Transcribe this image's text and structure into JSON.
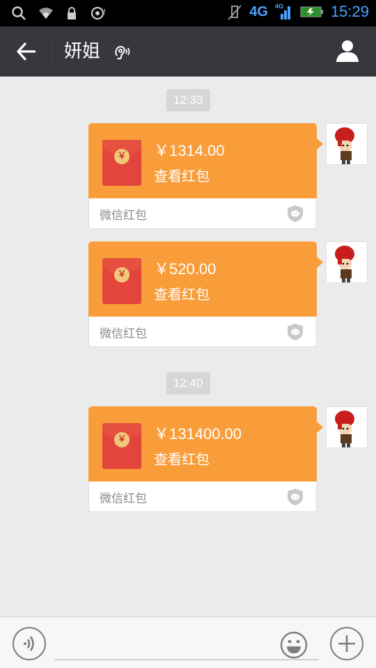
{
  "status_bar": {
    "network": "4G",
    "network_small": "4G",
    "time": "15:29",
    "icons": [
      "search-icon",
      "wifi-icon",
      "lock-icon",
      "notification-icon",
      "vibrate-icon",
      "signal-icon",
      "battery-icon"
    ]
  },
  "header": {
    "title": "妍姐",
    "icons": [
      "back-arrow-icon",
      "earpiece-icon",
      "profile-icon"
    ]
  },
  "messages": [
    {
      "type": "timestamp",
      "text": "12:33"
    },
    {
      "type": "red_packet",
      "amount": "￥1314.00",
      "action": "查看红包",
      "footer": "微信红包"
    },
    {
      "type": "red_packet",
      "amount": "￥520.00",
      "action": "查看红包",
      "footer": "微信红包"
    },
    {
      "type": "timestamp",
      "text": "12:40"
    },
    {
      "type": "red_packet",
      "amount": "￥131400.00",
      "action": "查看红包",
      "footer": "微信红包"
    }
  ],
  "red_packet_coin": "￥",
  "input_bar": {
    "placeholder": "",
    "icons": [
      "voice-icon",
      "emoji-icon",
      "plus-icon"
    ]
  },
  "colors": {
    "packet_orange": "#f99d3a",
    "envelope_red": "#e3443c",
    "title_bar": "#37383d",
    "status_blue": "#4aa3ff"
  }
}
